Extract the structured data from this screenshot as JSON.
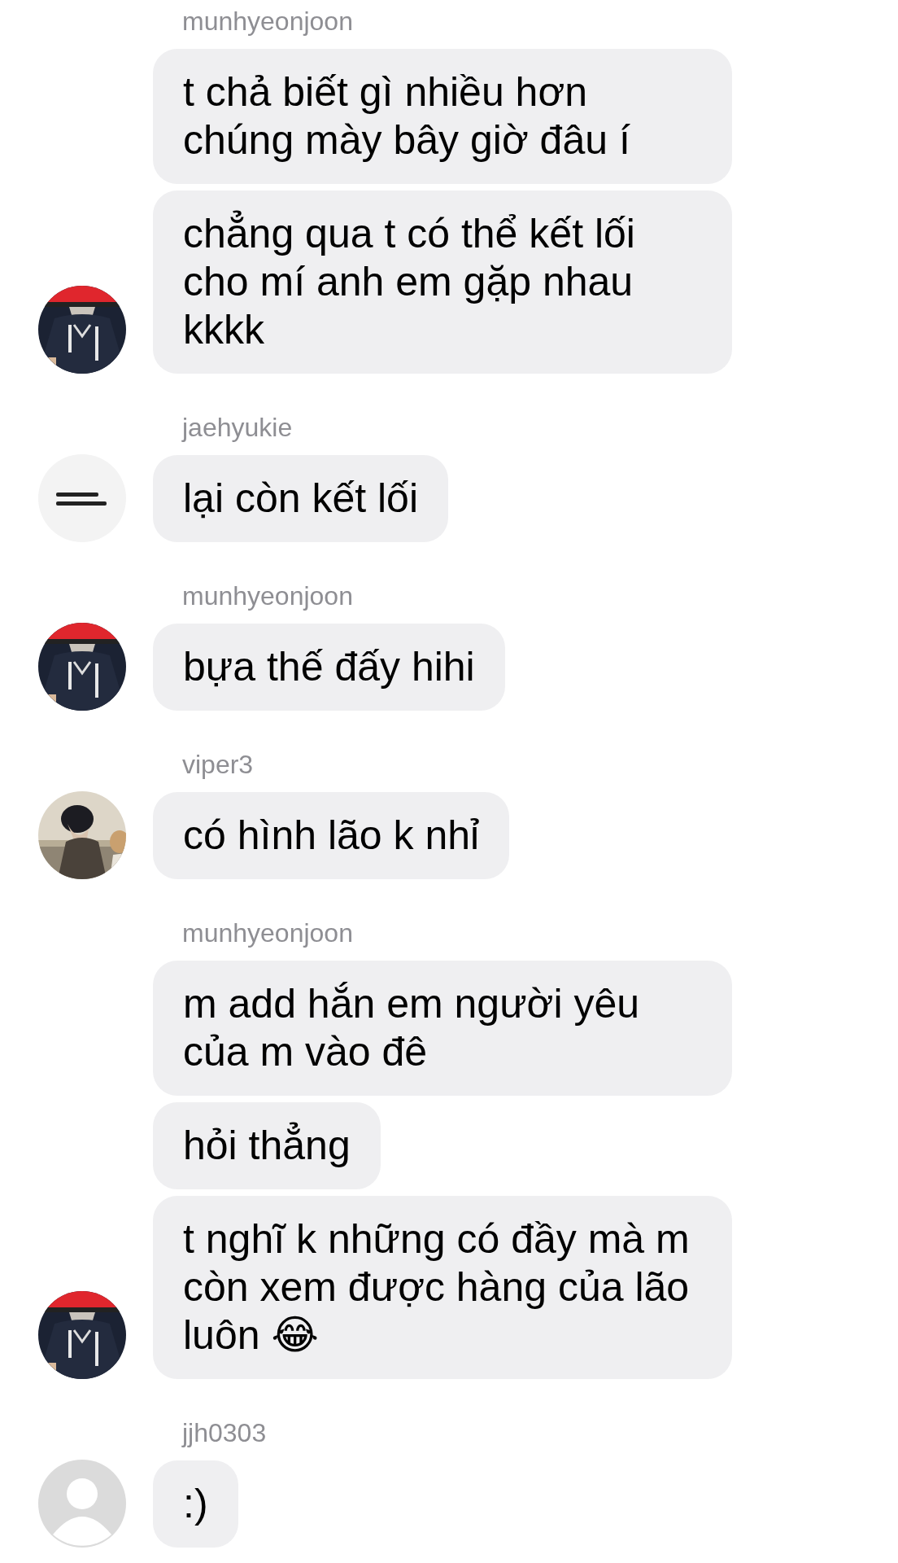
{
  "groups": [
    {
      "username": "munhyeonjoon",
      "avatar": {
        "kind": "picture"
      },
      "messages": [
        {
          "text": "t chả biết gì nhiều hơn chúng mày bây giờ đâu í"
        },
        {
          "text": "chẳng qua t có thể kết lối cho mí anh em gặp nhau kkkk"
        }
      ]
    },
    {
      "username": "jaehyukie",
      "avatar": {
        "kind": "picture"
      },
      "messages": [
        {
          "text": "lại còn kết lối"
        }
      ]
    },
    {
      "username": "munhyeonjoon",
      "avatar": {
        "kind": "picture"
      },
      "messages": [
        {
          "text": "bựa thế đấy hihi"
        }
      ]
    },
    {
      "username": "viper3",
      "avatar": {
        "kind": "picture"
      },
      "messages": [
        {
          "text": "có hình lão k nhỉ"
        }
      ]
    },
    {
      "username": "munhyeonjoon",
      "avatar": {
        "kind": "picture"
      },
      "messages": [
        {
          "text": "m add hắn em người yêu của m vào đê"
        },
        {
          "text": "hỏi thẳng"
        },
        {
          "text": "t nghĩ k những có đầy mà m còn xem được hàng của lão luôn 😂"
        }
      ]
    },
    {
      "username": "jjh0303",
      "avatar": {
        "kind": "placeholder"
      },
      "messages": [
        {
          "text": ":)"
        }
      ]
    }
  ]
}
